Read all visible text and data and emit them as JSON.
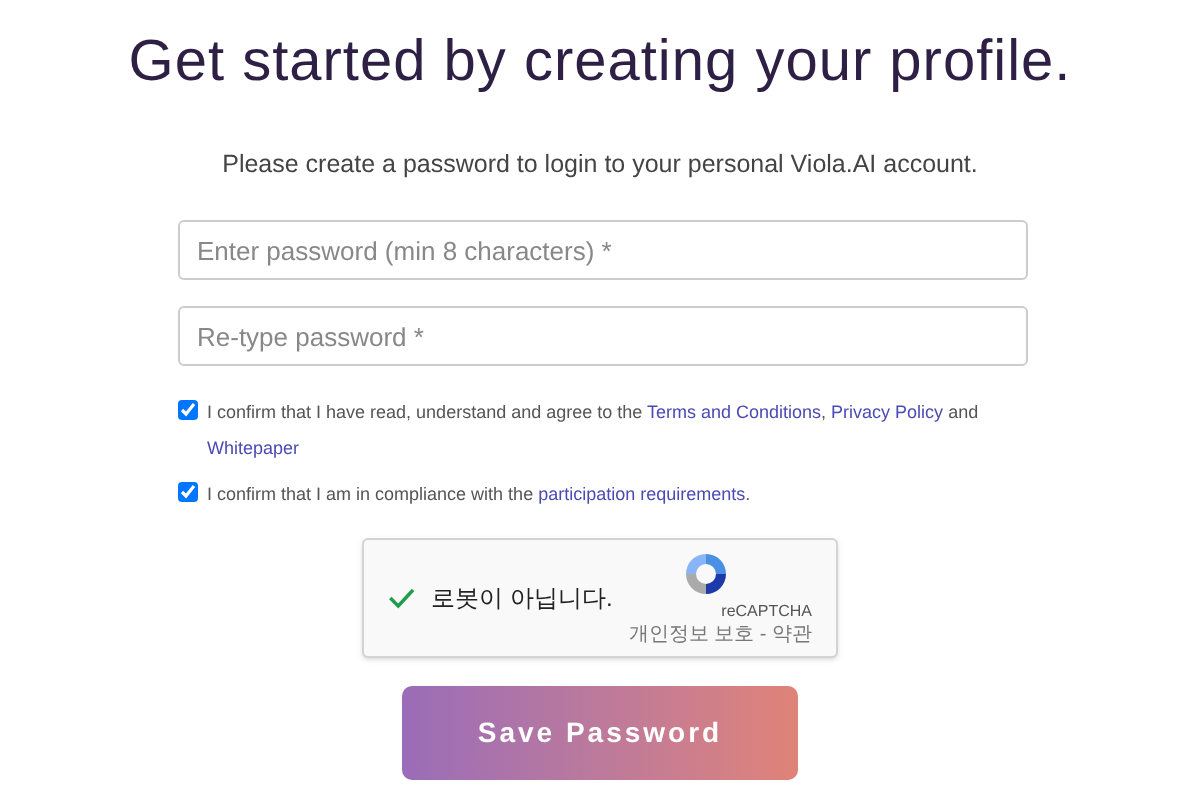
{
  "title": "Get started by creating your profile.",
  "subtitle": "Please create a password to login to your personal Viola.AI account.",
  "fields": [
    {
      "placeholder": "Enter password (min 8 characters) *"
    },
    {
      "placeholder": "Re-type password *"
    }
  ],
  "agreements": [
    {
      "checked": true,
      "parts": [
        {
          "kind": "text",
          "text": "I confirm that I have read, understand and agree to the "
        },
        {
          "kind": "link",
          "text": "Terms and Conditions"
        },
        {
          "kind": "text",
          "text": ", "
        },
        {
          "kind": "link",
          "text": "Privacy Policy"
        },
        {
          "kind": "text",
          "text": " and "
        },
        {
          "kind": "link",
          "text": "Whitepaper"
        }
      ]
    },
    {
      "checked": true,
      "parts": [
        {
          "kind": "text",
          "text": "I confirm that I am in compliance with the "
        },
        {
          "kind": "link",
          "text": "participation requirements"
        },
        {
          "kind": "text",
          "text": "."
        }
      ]
    }
  ],
  "captcha": {
    "checked": true,
    "label": "로봇이 아닙니다.",
    "brand": "reCAPTCHA",
    "footer": "개인정보 보호 - 약관"
  },
  "button": "Save Password"
}
